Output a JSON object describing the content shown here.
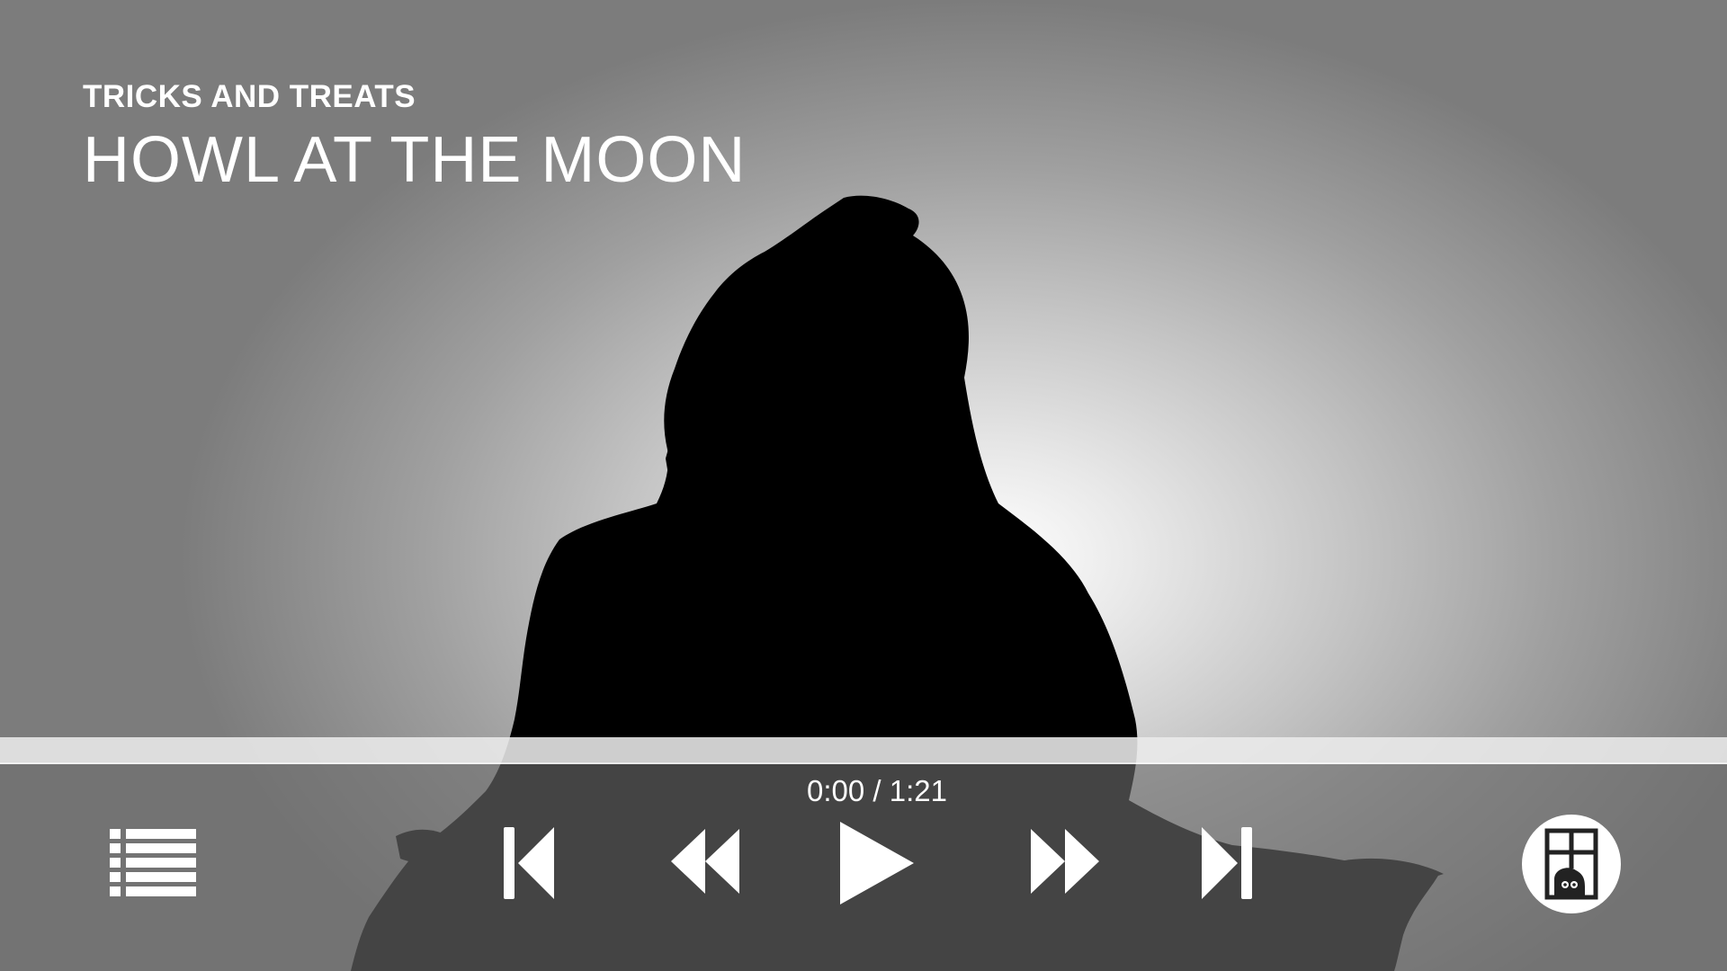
{
  "header": {
    "subtitle": "TRICKS AND TREATS",
    "title": "HOWL AT THE MOON"
  },
  "player": {
    "time_display": "0:00 / 1:21",
    "progress_fraction": 0
  },
  "controls": {
    "playlist_icon": "list-icon",
    "prev_icon": "skip-previous-icon",
    "rewind_icon": "rewind-icon",
    "play_icon": "play-icon",
    "forward_icon": "fast-forward-icon",
    "next_icon": "skip-next-icon",
    "home_icon": "haunted-house-icon"
  },
  "colors": {
    "controls": "#ffffff",
    "silhouette": "#000000"
  }
}
